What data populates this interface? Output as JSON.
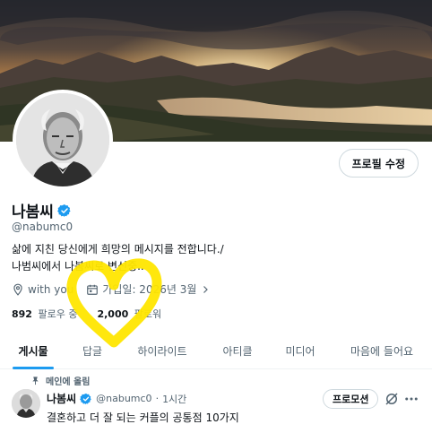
{
  "profile": {
    "display_name": "나봄씨",
    "handle": "@nabumc0",
    "bio_line1": "삶에 지친 당신에게 희망의 메시지를 전합니다./",
    "bio_line2": "나범씨에서 나봄씨로 변신중..",
    "location": "with you",
    "joined": "가입일: 2026년 3월",
    "following_count": "892",
    "following_label": "팔로우 중",
    "followers_count": "2,000",
    "followers_label": "팔로워",
    "edit_button": "프로필 수정"
  },
  "tabs": [
    {
      "label": "게시물",
      "active": true
    },
    {
      "label": "답글",
      "active": false
    },
    {
      "label": "하이라이트",
      "active": false
    },
    {
      "label": "아티클",
      "active": false
    },
    {
      "label": "미디어",
      "active": false
    },
    {
      "label": "마음에 들어요",
      "active": false
    }
  ],
  "pinned": {
    "label": "메인에 올림",
    "author": "나봄씨",
    "handle": "@nabumc0",
    "separator": "·",
    "time": "1시간",
    "text": "결혼하고 더 잘 되는 커플의 공통점 10가지",
    "promote_button": "프로모션"
  },
  "colors": {
    "accent": "#1d9bf0",
    "text": "#0f1419",
    "muted": "#536471",
    "heart": "#ffe600"
  },
  "icons": [
    "verified-badge-icon",
    "location-icon",
    "calendar-icon",
    "chevron-right-icon",
    "pin-icon",
    "grok-icon",
    "more-icon"
  ]
}
